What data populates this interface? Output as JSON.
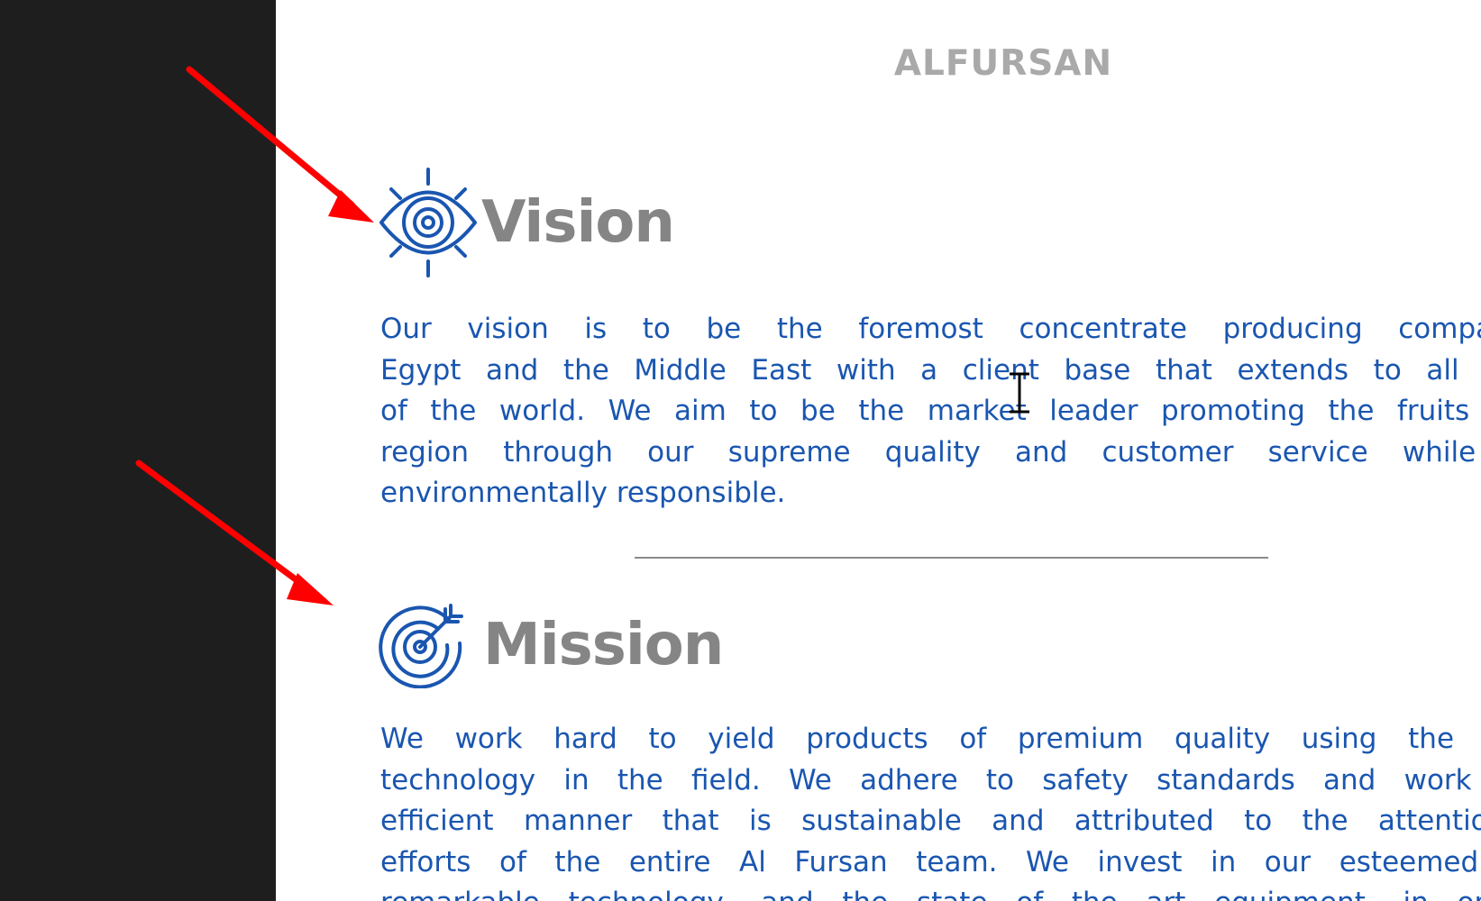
{
  "document": {
    "brand": "ALFURSAN",
    "vision": {
      "icon": "eye-icon",
      "title": "Vision",
      "lines": [
        "Our vision is to be the foremost concentrate producing company in",
        "Egypt and the Middle East with a client base that extends to all corners",
        "of the world. We aim to be the market leader promoting the fruits of the",
        "region through our supreme quality and customer service while being",
        "environmentally responsible."
      ]
    },
    "mission": {
      "icon": "target-arrow-icon",
      "title": "Mission",
      "lines": [
        "We work hard to yield products of premium quality using the leading",
        "technology in the field. We adhere to safety standards and work in an",
        "efficient manner that is sustainable and attributed to the attention and",
        "efforts of the entire Al Fursan team. We invest in our esteemed team,",
        "remarkable technology, and the state of the art equipment, in order to"
      ]
    }
  },
  "annotations": {
    "arrow_color": "#ff0000",
    "arrows": [
      "annotation-arrow-to-vision-icon",
      "annotation-arrow-to-mission-icon"
    ],
    "cursor": "text-cursor-icon"
  },
  "colors": {
    "body_text": "#1a56b0",
    "icon": "#1a56b0",
    "heading": "#858585",
    "brand": "#a9a9a9",
    "side_panel": "#1e1e1e"
  }
}
